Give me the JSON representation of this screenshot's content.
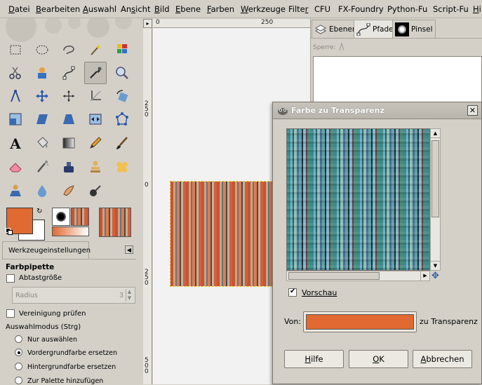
{
  "menubar": {
    "items": [
      {
        "pre": "",
        "u": "D",
        "post": "atei"
      },
      {
        "pre": "",
        "u": "B",
        "post": "earbeiten"
      },
      {
        "pre": "",
        "u": "A",
        "post": "uswahl"
      },
      {
        "pre": "An",
        "u": "s",
        "post": "icht"
      },
      {
        "pre": "",
        "u": "B",
        "post": "ild"
      },
      {
        "pre": "",
        "u": "E",
        "post": "bene"
      },
      {
        "pre": "",
        "u": "F",
        "post": "arben"
      },
      {
        "pre": "",
        "u": "W",
        "post": "erkzeuge"
      },
      {
        "pre": "Filte",
        "u": "r",
        "post": ""
      },
      {
        "pre": "CFU",
        "u": "",
        "post": ""
      },
      {
        "pre": "FX-Foundry",
        "u": "",
        "post": ""
      },
      {
        "pre": "Python-Fu",
        "u": "",
        "post": ""
      },
      {
        "pre": "Script-Fu",
        "u": "",
        "post": ""
      },
      {
        "pre": "",
        "u": "H",
        "post": "ilfe"
      }
    ]
  },
  "colors": {
    "foreground": "#e06a32",
    "background": "#ffffff",
    "swatch": "#e06a32"
  },
  "tool_options": {
    "tab_label": "Werkzeugeinstellungen",
    "title": "Farbpipette",
    "sample_average": "Abtastgröße",
    "radius_label": "Radius",
    "radius_value": "3",
    "sample_merged": "Vereinigung prüfen",
    "pick_mode_label": "Auswahlmodus  (Strg)",
    "modes": [
      {
        "label": "Nur auswählen",
        "selected": false
      },
      {
        "label": "Vordergrundfarbe ersetzen",
        "selected": true
      },
      {
        "label": "Hintergrundfarbe ersetzen",
        "selected": false
      },
      {
        "label": "Zur Palette hinzufügen",
        "selected": false
      }
    ]
  },
  "rulers": {
    "top": [
      "0",
      "250"
    ],
    "left": [
      "2\n5\n0",
      "0",
      "2\n5\n0",
      "5\n0\n0"
    ]
  },
  "dock": {
    "tabs": [
      "Ebenen",
      "Pfade",
      "Pinsel"
    ],
    "lock_label": "Sperre:"
  },
  "dialog": {
    "title": "Farbe zu Transparenz",
    "preview_label": "Vorschau",
    "preview_checked": true,
    "from_label": "Von:",
    "to_label": "zu Transparenz",
    "buttons": {
      "help": {
        "pre": "",
        "u": "H",
        "post": "ilfe"
      },
      "ok": {
        "pre": "",
        "u": "O",
        "post": "K"
      },
      "cancel": {
        "pre": "",
        "u": "A",
        "post": "bbrechen"
      }
    }
  }
}
